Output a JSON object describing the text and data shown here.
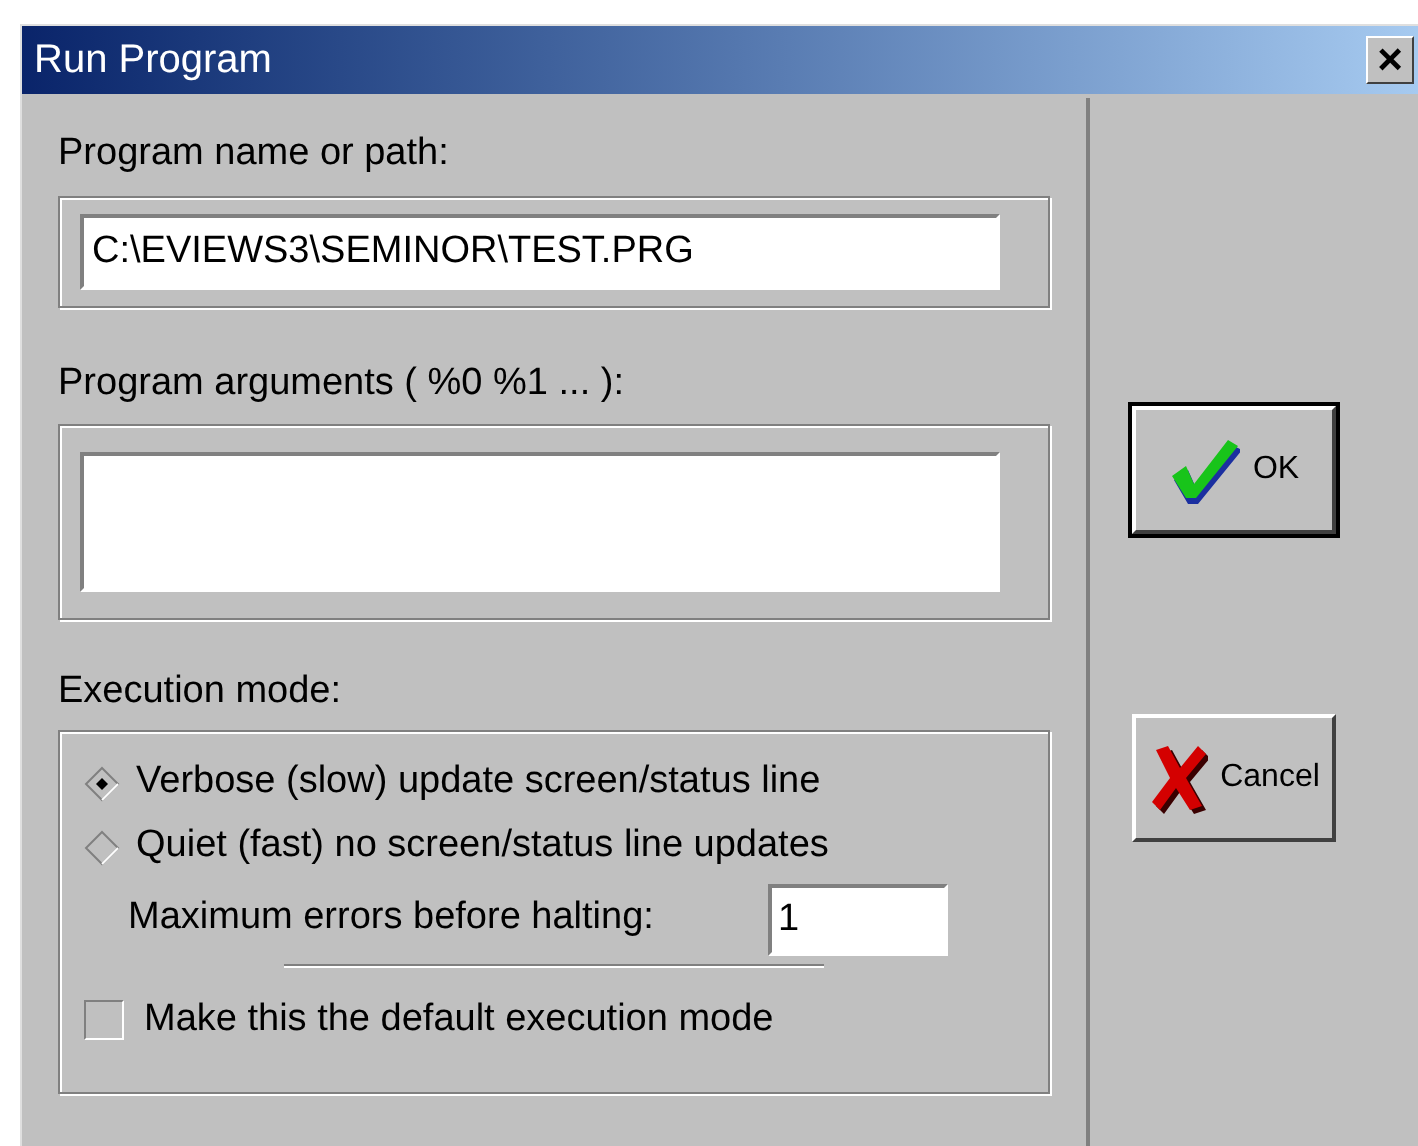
{
  "window": {
    "title": "Run Program",
    "close": "×"
  },
  "program_name": {
    "label": "Program name or path:",
    "value": "C:\\EVIEWS3\\SEMINOR\\TEST.PRG"
  },
  "program_arguments": {
    "label": "Program arguments ( %0  %1 ... ):"
  },
  "execution_mode": {
    "label": "Execution mode:",
    "options": [
      {
        "label": "Verbose (slow) update screen/status line",
        "selected": true
      },
      {
        "label": "Quiet (fast) no screen/status line updates",
        "selected": false
      }
    ],
    "max_errors": {
      "label": "Maximum errors before halting:",
      "value": "1"
    },
    "default_mode": {
      "label": "Make this the default execution mode",
      "checked": false
    }
  },
  "buttons": [
    {
      "kind": "ok",
      "label": "OK",
      "default": true
    },
    {
      "kind": "cancel",
      "label": "Cancel",
      "default": false
    }
  ]
}
